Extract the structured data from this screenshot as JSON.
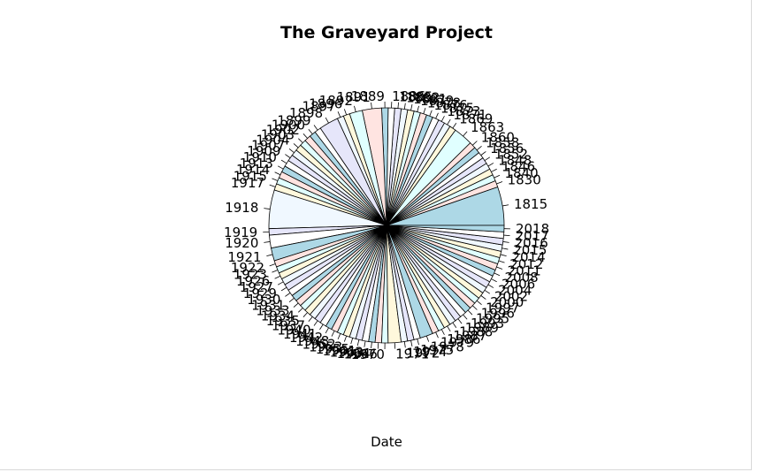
{
  "chart_data": {
    "type": "pie",
    "title": "The Graveyard Project",
    "xlabel": "Date",
    "ylabel": "",
    "legend": "none",
    "grid": false,
    "colors": [
      "#add8e6",
      "#ffe4e1",
      "#e0ffff",
      "#fff8dc",
      "#f0f8ff",
      "#e6e6fa",
      "#ffffff"
    ],
    "categories": [
      "1815",
      "1830",
      "1840",
      "1846",
      "1848",
      "1852",
      "1856",
      "1858",
      "1860",
      "1863",
      "1869",
      "1871",
      "1873",
      "1875",
      "1876",
      "1878",
      "1879",
      "1881",
      "1882",
      "1885",
      "1886",
      "1889",
      "1891",
      "1892",
      "1896",
      "1897",
      "1898",
      "1899",
      "1900",
      "1902",
      "1903",
      "1904",
      "1907",
      "1909",
      "1910",
      "1913",
      "1914",
      "1915",
      "1917",
      "1918",
      "1919",
      "1920",
      "1921",
      "1922",
      "1923",
      "1926",
      "1927",
      "1929",
      "1930",
      "1931",
      "1933",
      "1934",
      "1935",
      "1937",
      "1940",
      "1941",
      "1942",
      "1948",
      "1952",
      "1953",
      "1955",
      "1961",
      "1963",
      "1964",
      "1966",
      "1970",
      "1971",
      "1972",
      "1974",
      "1975",
      "1978",
      "1979",
      "1986",
      "1987",
      "1988",
      "1989",
      "1993",
      "1995",
      "1996",
      "1997",
      "2000",
      "2002",
      "2004",
      "2006",
      "2008",
      "2011",
      "2012",
      "2014",
      "2015",
      "2016",
      "2017",
      "2018"
    ],
    "values": [
      6,
      1,
      1,
      1,
      1,
      1,
      1,
      1,
      1,
      3,
      1,
      1,
      1,
      1,
      1,
      1,
      1,
      1,
      1,
      1,
      1,
      1,
      3,
      2,
      1,
      1,
      3,
      1,
      1,
      1,
      1,
      1,
      1,
      1,
      1,
      1,
      1,
      1,
      1,
      6,
      1,
      2,
      2,
      1,
      1,
      1,
      1,
      1,
      1,
      1,
      1,
      1,
      1,
      1,
      1,
      1,
      1,
      1,
      1,
      1,
      1,
      1,
      1,
      1,
      1,
      1,
      2,
      1,
      1,
      1,
      2,
      1,
      1,
      1,
      1,
      1,
      1,
      1,
      1,
      1,
      1,
      1,
      1,
      1,
      1,
      1,
      1,
      1,
      1,
      1,
      1,
      1
    ]
  }
}
